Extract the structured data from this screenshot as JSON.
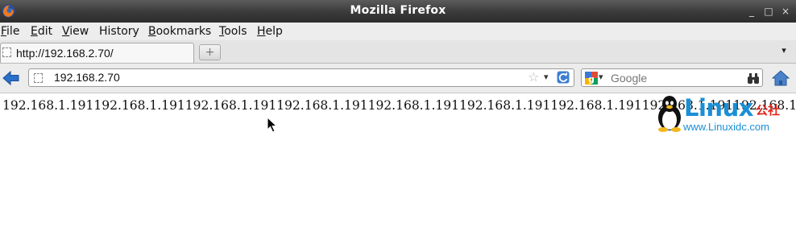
{
  "window": {
    "title": "Mozilla Firefox",
    "controls": [
      "minimize-icon",
      "maximize-icon",
      "close-icon"
    ]
  },
  "menu": {
    "items": [
      {
        "label": "File",
        "mnemonic": "F",
        "rest": "ile"
      },
      {
        "label": "Edit",
        "mnemonic": "E",
        "rest": "dit"
      },
      {
        "label": "View",
        "mnemonic": "V",
        "rest": "iew"
      },
      {
        "label": "History",
        "mnemonic": "",
        "rest": "History"
      },
      {
        "label": "Bookmarks",
        "mnemonic": "B",
        "rest": "ookmarks"
      },
      {
        "label": "Tools",
        "mnemonic": "T",
        "rest": "ools"
      },
      {
        "label": "Help",
        "mnemonic": "H",
        "rest": "elp"
      }
    ]
  },
  "tabs": {
    "active_label": "http://192.168.2.70/",
    "new_tab_glyph": "+"
  },
  "navbar": {
    "url": "192.168.2.70",
    "search_placeholder": "Google"
  },
  "page": {
    "body_text": "192.168.1.191192.168.1.191192.168.1.191192.168.1.191192.168.1.191192.168.1.191192.168.1.191192.168.1.191192.168.1.191192.168.1.191"
  },
  "watermark": {
    "brand": "Linux",
    "brand_cn": "公社",
    "url": "www.Linuxidc.com"
  },
  "colors": {
    "titlebar": "#3a3a3a",
    "watermark_blue": "#1a8fd6",
    "watermark_red": "#e0251b"
  }
}
